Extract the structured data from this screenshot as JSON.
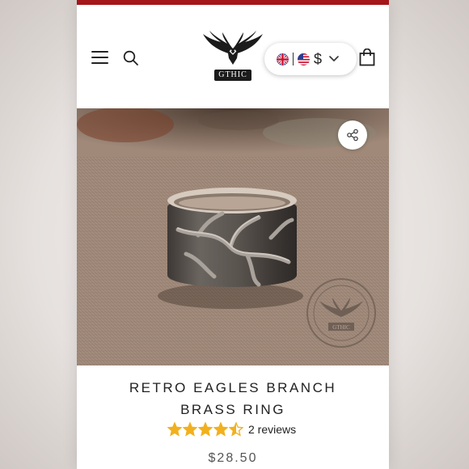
{
  "header": {
    "logo_text": "GTHIC",
    "currency_symbol": "$"
  },
  "product": {
    "title_line1": "RETRO EAGLES BRANCH",
    "title_line2": "BRASS RING",
    "rating": 4.5,
    "rating_max": 5,
    "reviews_text": "2 reviews",
    "price": "$28.50",
    "watermark_text": "GTHIC"
  },
  "colors": {
    "brand_red": "#a4161a",
    "star_gold": "#f2b01e"
  }
}
